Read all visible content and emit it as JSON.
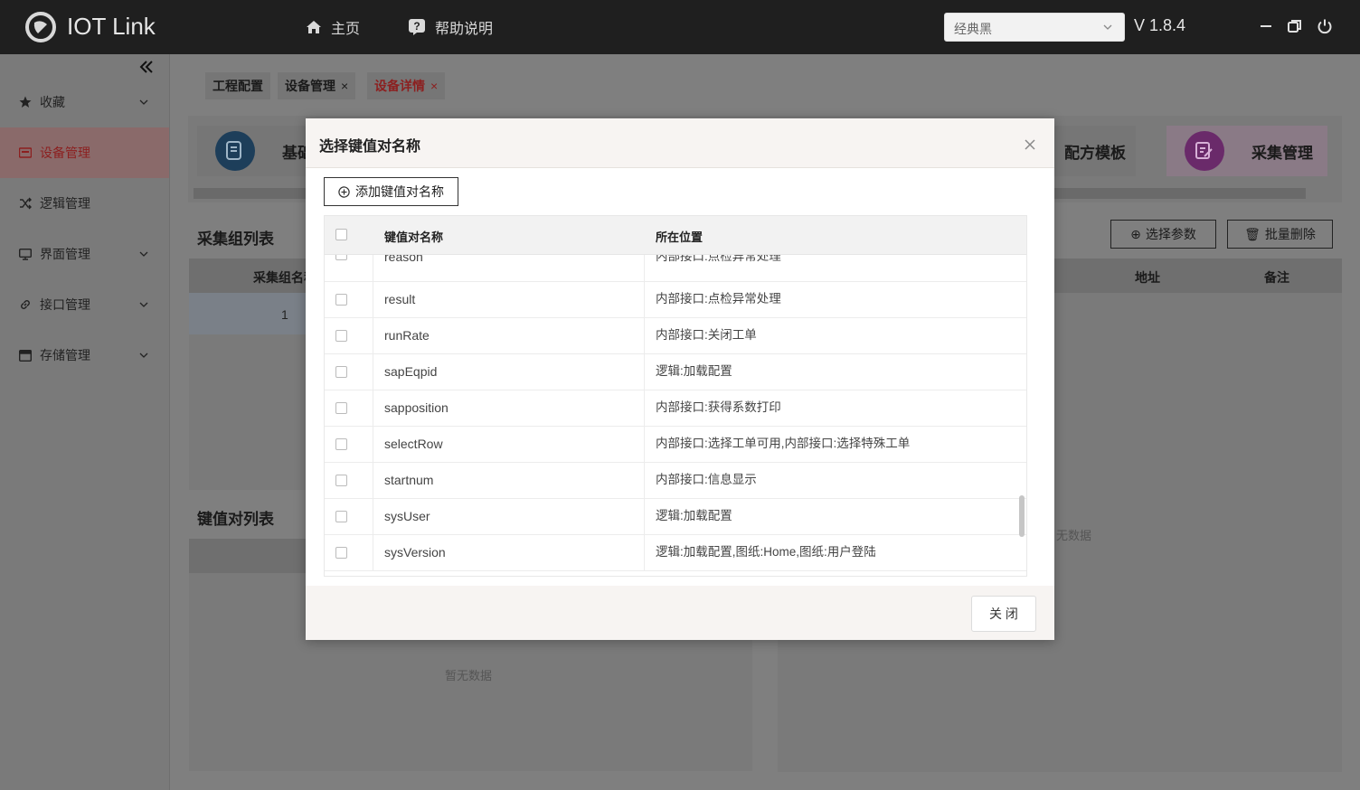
{
  "app": {
    "title": "IOT Link",
    "version": "V 1.8.4"
  },
  "topnav": {
    "home": "主页",
    "help": "帮助说明"
  },
  "theme": {
    "selected": "经典黑"
  },
  "sidebar": {
    "items": [
      {
        "label": "收藏"
      },
      {
        "label": "设备管理"
      },
      {
        "label": "逻辑管理"
      },
      {
        "label": "界面管理"
      },
      {
        "label": "接口管理"
      },
      {
        "label": "存储管理"
      }
    ]
  },
  "tabs": [
    {
      "label": "工程配置"
    },
    {
      "label": "设备管理",
      "close": "×"
    },
    {
      "label": "设备详情",
      "close": "×"
    }
  ],
  "cards": {
    "basic": "基础",
    "recipe": "配方模板",
    "collect": "采集管理"
  },
  "background": {
    "group_list_title": "采集组列表",
    "group_col_name": "采集组名称",
    "group_row_1": "1",
    "kv_list_title": "键值对列表",
    "select_param": "选择参数",
    "batch_delete": "批量删除",
    "col_addr": "地址",
    "col_remark": "备注",
    "empty_left": "暂无数据",
    "empty_right": "无数据"
  },
  "modal": {
    "title": "选择键值对名称",
    "add_button": "添加键值对名称",
    "columns": {
      "name": "键值对名称",
      "location": "所在位置"
    },
    "rows": [
      {
        "name": "reason",
        "location": "内部接口:点检异常处理"
      },
      {
        "name": "result",
        "location": "内部接口:点检异常处理"
      },
      {
        "name": "runRate",
        "location": "内部接口:关闭工单"
      },
      {
        "name": "sapEqpid",
        "location": "逻辑:加载配置"
      },
      {
        "name": "sapposition",
        "location": "内部接口:获得系数打印"
      },
      {
        "name": "selectRow",
        "location": "内部接口:选择工单可用,内部接口:选择特殊工单"
      },
      {
        "name": "startnum",
        "location": "内部接口:信息显示"
      },
      {
        "name": "sysUser",
        "location": "逻辑:加载配置"
      },
      {
        "name": "sysVersion",
        "location": "逻辑:加载配置,图纸:Home,图纸:用户登陆"
      }
    ],
    "close_button": "关 闭"
  }
}
